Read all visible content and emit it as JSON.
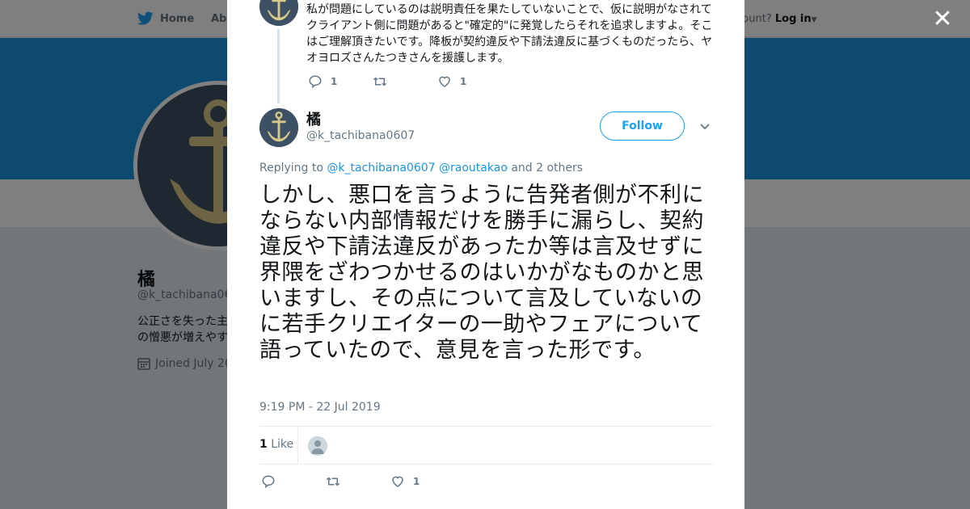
{
  "nav": {
    "home_label": "Home",
    "about_label": "Abo",
    "account_prompt": "ccount?",
    "login_label": "Log in"
  },
  "profile": {
    "name": "橘",
    "handle": "@k_tachibana060",
    "bio_line1": "公正さを失った主",
    "bio_line2": "の憎悪が増えやす",
    "joined": "Joined July 20"
  },
  "prev_tweet": {
    "text": "私が問題にしているのは説明責任を果たしていないことで、仮に説明がなされてクライアント側に問題があると\"確定的\"に発覚したらそれを追求しますよ。そこはご理解頂きたいです。降板が契約違反や下請法違反に基づくものだったら、ヤオヨロズさんたつきさんを援護します。",
    "reply_count": "1",
    "retweet_count": "",
    "like_count": "1"
  },
  "tweet": {
    "author_name": "橘",
    "author_handle": "@k_tachibana0607",
    "follow_label": "Follow",
    "replying_prefix": "Replying to",
    "replying_user1": "@k_tachibana0607",
    "replying_user2": "@raoutakao",
    "replying_suffix": "and 2 others",
    "text": "しかし、悪口を言うように告発者側が不利にならない内部情報だけを勝手に漏らし、契約違反や下請法違反があったか等は言及せずに界隈をざわつかせるのはいかがなものかと思いますし、その点について言及していないのに若手クリエイターの一助やフェアについて語っていたので、意見を言った形です。",
    "timestamp": "9:19 PM - 22 Jul 2019",
    "like_stat_count": "1",
    "like_stat_label": "Like",
    "like_count": "1"
  },
  "colors": {
    "accent": "#1da1f2",
    "banner": "#1b95e0",
    "avatar_bg": "#3e5063",
    "anchor": "#d8c98a"
  },
  "icons": {
    "close": "close-icon",
    "reply": "reply-icon",
    "retweet": "retweet-icon",
    "like": "heart-icon"
  }
}
